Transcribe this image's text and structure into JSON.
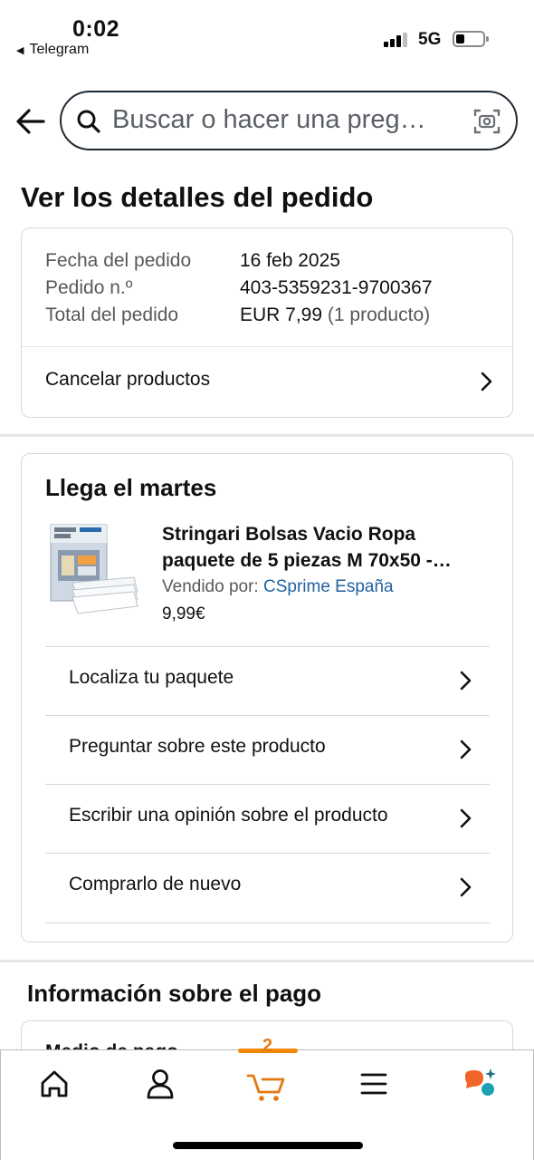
{
  "status_bar": {
    "time": "0:02",
    "back_app": "Telegram",
    "network": "5G"
  },
  "search": {
    "placeholder": "Buscar o hacer una preg…"
  },
  "page_title": "Ver los detalles del pedido",
  "order_summary": {
    "date_label": "Fecha del pedido",
    "date_value": "16 feb 2025",
    "number_label": "Pedido n.º",
    "number_value": "403-5359231-9700367",
    "total_label": "Total del pedido",
    "total_value": "EUR 7,99",
    "total_items": "(1 producto)",
    "cancel_label": "Cancelar productos"
  },
  "shipment": {
    "arrival": "Llega el martes",
    "product_title": "Stringari Bolsas Vacio Ropa paquete de 5 piezas M 70x50 -…",
    "sold_by_label": "Vendido por:",
    "seller": "CSprime España",
    "price": "9,99€",
    "actions": [
      {
        "label": "Localiza tu paquete"
      },
      {
        "label": "Preguntar sobre este producto"
      },
      {
        "label": "Escribir una opinión sobre el producto"
      },
      {
        "label": "Comprarlo de nuevo"
      }
    ]
  },
  "payment": {
    "title": "Información sobre el pago",
    "method_label": "Medio de pago"
  },
  "bottom_nav": {
    "cart_count": "2",
    "accent_color": "#f08804",
    "items": [
      "home-icon",
      "account-icon",
      "cart-icon",
      "menu-icon",
      "rufus-icon"
    ]
  }
}
